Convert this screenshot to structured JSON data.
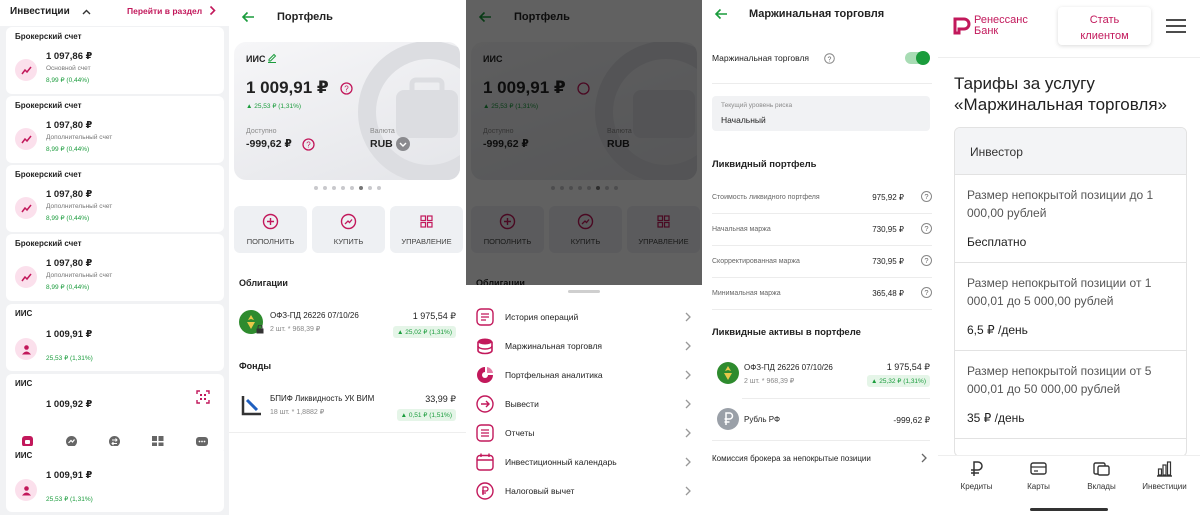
{
  "panel1": {
    "header_title": "Инвестиции",
    "header_link": "Перейти в раздел",
    "accounts": [
      {
        "title": "Брокерский счет",
        "amount": "1 097,86 ₽",
        "subtitle": "Основной счет",
        "change": "8,99 ₽ (0,44%)"
      },
      {
        "title": "Брокерский счет",
        "amount": "1 097,80 ₽",
        "subtitle": "Дополнительный счет",
        "change": "8,99 ₽ (0,44%)"
      },
      {
        "title": "Брокерский счет",
        "amount": "1 097,80 ₽",
        "subtitle": "Дополнительный счет",
        "change": "8,99 ₽ (0,44%)"
      },
      {
        "title": "Брокерский счет",
        "amount": "1 097,80 ₽",
        "subtitle": "Дополнительный счет",
        "change": "8,99 ₽ (0,44%)"
      },
      {
        "title": "ИИС",
        "amount": "1 009,91 ₽",
        "subtitle": "",
        "change": "25,53 ₽ (1,31%)"
      },
      {
        "title": "ИИС",
        "amount": "1 009,92 ₽",
        "subtitle": "",
        "change": ""
      },
      {
        "title": "ИИС",
        "amount": "1 009,91 ₽",
        "subtitle": "",
        "change": "25,53 ₽ (1,31%)"
      }
    ]
  },
  "portfolio": {
    "title": "Портфель",
    "account_name": "ИИС",
    "balance": "1 009,91 ₽",
    "balance_change": "25,53 ₽ (1,31%)",
    "available_label": "Доступно",
    "available_value": "-999,62 ₽",
    "currency_label": "Валюта",
    "currency_value": "RUB",
    "actions": [
      "ПОПОЛНИТЬ",
      "КУПИТЬ",
      "УПРАВЛЕНИЕ"
    ],
    "bonds_title": "Облигации",
    "bond": {
      "name": "ОФЗ-ПД 26226 07/10/26",
      "qty": "2 шт. * 968,39 ₽",
      "amount": "1 975,54 ₽",
      "change": "25,02 ₽ (1,31%)"
    },
    "funds_title": "Фонды",
    "fund": {
      "name": "БПИФ Ликвидность УК ВИМ",
      "qty": "18 шт. * 1,8882 ₽",
      "amount": "33,99 ₽",
      "change": "0,51 ₽ (1,51%)"
    }
  },
  "menu": {
    "items": [
      {
        "label": "История операций",
        "icon": "list-icon"
      },
      {
        "label": "Маржинальная торговля",
        "icon": "coins-icon"
      },
      {
        "label": "Портфельная аналитика",
        "icon": "pie-icon"
      },
      {
        "label": "Вывести",
        "icon": "arrow-out-icon"
      },
      {
        "label": "Отчеты",
        "icon": "document-icon"
      },
      {
        "label": "Инвестиционный календарь",
        "icon": "calendar-icon"
      },
      {
        "label": "Налоговый вычет",
        "icon": "ruble-icon"
      }
    ]
  },
  "margin": {
    "title": "Маржинальная торговля",
    "toggle_label": "Маржинальная торговля",
    "toggle_on": true,
    "risk_label": "Текущий уровень риска",
    "risk_value": "Начальный",
    "liquid_title": "Ликвидный портфель",
    "rows": [
      {
        "label": "Стоимость ликвидного портфеля",
        "value": "975,92 ₽"
      },
      {
        "label": "Начальная маржа",
        "value": "730,95 ₽"
      },
      {
        "label": "Скорректированная маржа",
        "value": "730,95 ₽"
      },
      {
        "label": "Минимальная маржа",
        "value": "365,48 ₽"
      }
    ],
    "assets_title": "Ликвидные активы в портфеле",
    "asset1": {
      "name": "ОФЗ-ПД 26226 07/10/26",
      "qty": "2 шт. * 968,39 ₽",
      "amount": "1 975,54 ₽",
      "change": "25,32 ₽ (1,31%)"
    },
    "asset2": {
      "name": "Рубль РФ",
      "amount": "-999,62 ₽"
    },
    "commission": "Комиссия брокера за непокрытые позиции"
  },
  "bank": {
    "logo_line1": "Ренессанс",
    "logo_line2": "Банк",
    "cta": "Стать клиентом",
    "heading": "Тарифы за услугу «Маржинальная торговля»",
    "table_header": "Инвестор",
    "tiers": [
      {
        "desc": "Размер непокрытой позиции до 1 000,00 рублей",
        "value": "Бесплатно"
      },
      {
        "desc": "Размер непокрытой позиции от 1 000,01 до 5 000,00 рублей",
        "value": "6,5 ₽ /день"
      },
      {
        "desc": "Размер непокрытой позиции от 5 000,01 до 50 000,00 рублей",
        "value": "35 ₽ /день"
      }
    ],
    "nav": [
      "Кредиты",
      "Карты",
      "Вклады",
      "Инвестиции"
    ]
  },
  "colors": {
    "accent_pink": "#c2185b",
    "accent_green": "#1a9c3c"
  }
}
